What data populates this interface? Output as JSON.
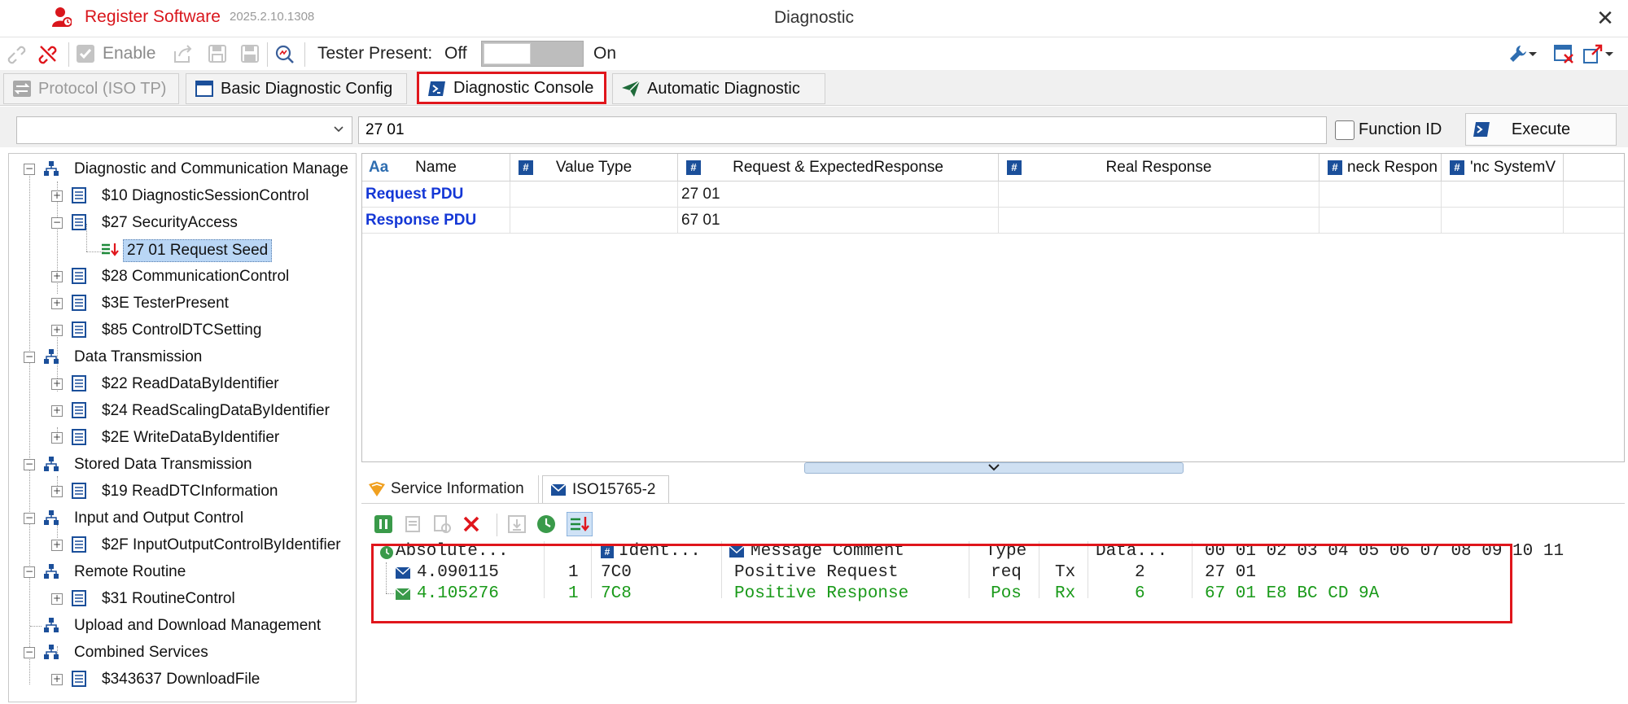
{
  "titlebar": {
    "register_label": "Register Software",
    "version": "2025.2.10.1308",
    "window_title": "Diagnostic",
    "close_glyph": "✕"
  },
  "toolbar": {
    "enable_label": "Enable",
    "tester_present_label": "Tester Present:",
    "off_label": "Off",
    "on_label": "On",
    "icons": [
      "link-icon",
      "unlink-icon",
      "checkbox-icon",
      "export-icon",
      "save-icon",
      "save-as-icon",
      "search-icon",
      "wrench-icon",
      "close-window-icon",
      "detach-icon"
    ]
  },
  "tabs": [
    {
      "label": "Protocol (ISO TP)",
      "icon": "swap-icon",
      "enabled": false
    },
    {
      "label": "Basic Diagnostic Config",
      "icon": "window-icon",
      "enabled": true
    },
    {
      "label": "Diagnostic Console",
      "icon": "console-icon",
      "active": true
    },
    {
      "label": "Automatic Diagnostic",
      "icon": "send-icon",
      "enabled": true
    }
  ],
  "command": {
    "service_value": "",
    "request_value": "27 01",
    "function_id_label": "Function ID",
    "function_id_checked": false,
    "execute_label": "Execute"
  },
  "tree": {
    "nodes": [
      {
        "label": "Diagnostic and Communication Manage",
        "level": 0
      },
      {
        "label": "$10 DiagnosticSessionControl",
        "level": 1
      },
      {
        "label": "$27 SecurityAccess",
        "level": 1,
        "expanded": true
      },
      {
        "label": "27 01 Request Seed",
        "level": 2,
        "selected": true
      },
      {
        "label": "$28 CommunicationControl",
        "level": 1
      },
      {
        "label": "$3E TesterPresent",
        "level": 1
      },
      {
        "label": "$85 ControlDTCSetting",
        "level": 1
      },
      {
        "label": "Data Transmission",
        "level": 0
      },
      {
        "label": "$22 ReadDataByIdentifier",
        "level": 1
      },
      {
        "label": "$24 ReadScalingDataByIdentifier",
        "level": 1
      },
      {
        "label": "$2E WriteDataByIdentifier",
        "level": 1
      },
      {
        "label": "Stored Data Transmission",
        "level": 0
      },
      {
        "label": "$19 ReadDTCInformation",
        "level": 1
      },
      {
        "label": "Input and Output Control",
        "level": 0
      },
      {
        "label": "$2F InputOutputControlByIdentifier",
        "level": 1
      },
      {
        "label": "Remote Routine",
        "level": 0
      },
      {
        "label": "$31 RoutineControl",
        "level": 1
      },
      {
        "label": "Upload and Download Management",
        "level": 0
      },
      {
        "label": "Combined Services",
        "level": 0
      },
      {
        "label": "$343637 DownloadFile",
        "level": 1
      }
    ]
  },
  "grid": {
    "columns": [
      "Name",
      "Value Type",
      "Request & ExpectedResponse",
      "Real Response",
      "neck Respon",
      "'nc SystemV"
    ],
    "aa_glyph": "Aa",
    "hash_glyph": "#",
    "rows": [
      {
        "name": "Request PDU",
        "value_type": "",
        "request": "27 01",
        "real": ""
      },
      {
        "name": "Response PDU",
        "value_type": "",
        "request": "67 01",
        "real": ""
      }
    ]
  },
  "lower_tabs": [
    {
      "label": "Service Information",
      "icon": "tag-icon"
    },
    {
      "label": "ISO15765-2",
      "icon": "envelope-icon",
      "active": true
    }
  ],
  "trace": {
    "headers": {
      "absolute": "Absolute...",
      "ident": "Ident...",
      "comment": "Message Comment",
      "type": "Type",
      "data_len": "Data...",
      "bytes": "00 01 02 03 04 05 06 07 08 09 10 11"
    },
    "rows": [
      {
        "time": "4.090115",
        "chan": "1",
        "ident": "7C0",
        "comment": "Positive Request",
        "type": "req",
        "dir": "Tx",
        "dlc": "2",
        "data": "27 01"
      },
      {
        "time": "4.105276",
        "chan": "1",
        "ident": "7C8",
        "comment": "Positive Response",
        "type": "Pos",
        "dir": "Rx",
        "dlc": "6",
        "data": "67 01 E8 BC CD 9A"
      }
    ]
  },
  "colors": {
    "accent_red": "#e0161c",
    "pdu_blue": "#1437d6",
    "response_green": "#1a9a1a",
    "selection": "#b9d6f5"
  }
}
